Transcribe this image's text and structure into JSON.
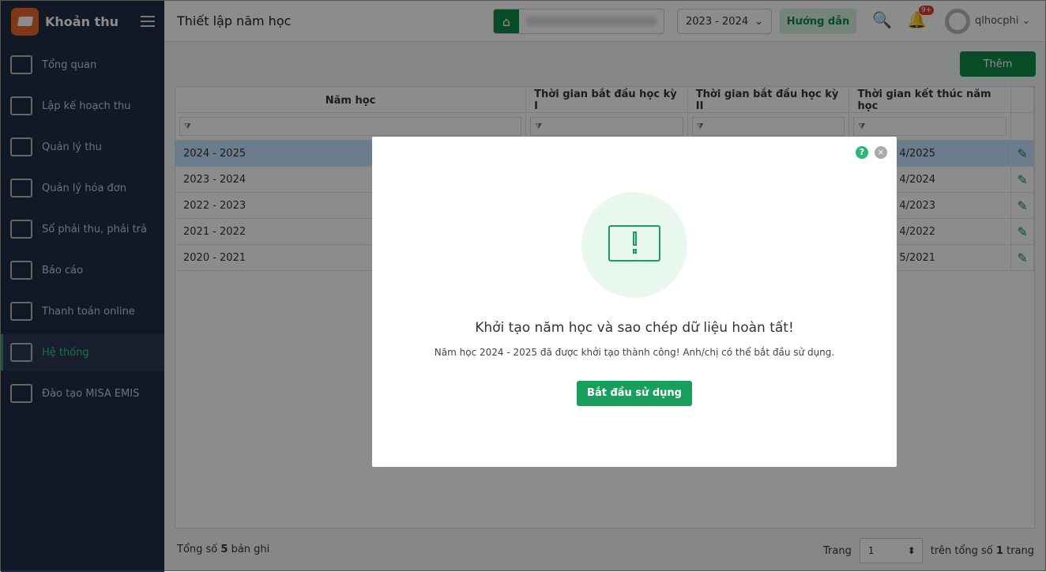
{
  "app": {
    "name": "Khoản thu"
  },
  "sidebar": {
    "items": [
      {
        "label": "Tổng quan",
        "icon": "bar-chart-icon"
      },
      {
        "label": "Lập kế hoạch thu",
        "icon": "calendar-money-icon"
      },
      {
        "label": "Quản lý thu",
        "icon": "hand-money-icon"
      },
      {
        "label": "Quản lý hóa đơn",
        "icon": "document-icon"
      },
      {
        "label": "Sổ phải thu, phải trả",
        "icon": "ledger-icon"
      },
      {
        "label": "Báo cáo",
        "icon": "pie-chart-icon"
      },
      {
        "label": "Thanh toán online",
        "icon": "card-icon"
      },
      {
        "label": "Hệ thống",
        "icon": "gear-icon",
        "active": true
      },
      {
        "label": "Đào tạo MISA EMIS",
        "icon": "book-icon"
      }
    ]
  },
  "header": {
    "title": "Thiết lập năm học",
    "year": "2023 - 2024",
    "guide": "Hướng dẫn",
    "badge": "9+",
    "user": "qlhocphi"
  },
  "toolbar": {
    "add": "Thêm"
  },
  "table": {
    "columns": [
      "Năm học",
      "Thời gian bắt đầu học kỳ I",
      "Thời gian bắt đầu học kỳ II",
      "Thời gian kết thúc năm học"
    ],
    "rows": [
      {
        "year": "2024 - 2025",
        "end": "4/2025"
      },
      {
        "year": "2023 - 2024",
        "end": "4/2024"
      },
      {
        "year": "2022 - 2023",
        "end": "4/2023"
      },
      {
        "year": "2021 - 2022",
        "end": "4/2022"
      },
      {
        "year": "2020 - 2021",
        "end": "5/2021"
      }
    ]
  },
  "footer": {
    "total_prefix": "Tổng số",
    "total": "5",
    "total_suffix": "bản ghi",
    "page_label": "Trang",
    "page": "1",
    "of_prefix": "trên tổng số",
    "pages": "1",
    "of_suffix": "trang"
  },
  "modal": {
    "title": "Khởi tạo năm học và sao chép dữ liệu hoàn tất!",
    "text": "Năm học 2024 - 2025 đã được khởi tạo thành công! Anh/chị có thể bắt đầu sử dụng.",
    "button": "Bắt đầu sử dụng",
    "help": "?",
    "close": "×"
  },
  "colors": {
    "primary": "#0d8a46",
    "sidebar": "#1f2d45",
    "accent": "#17a05d"
  }
}
